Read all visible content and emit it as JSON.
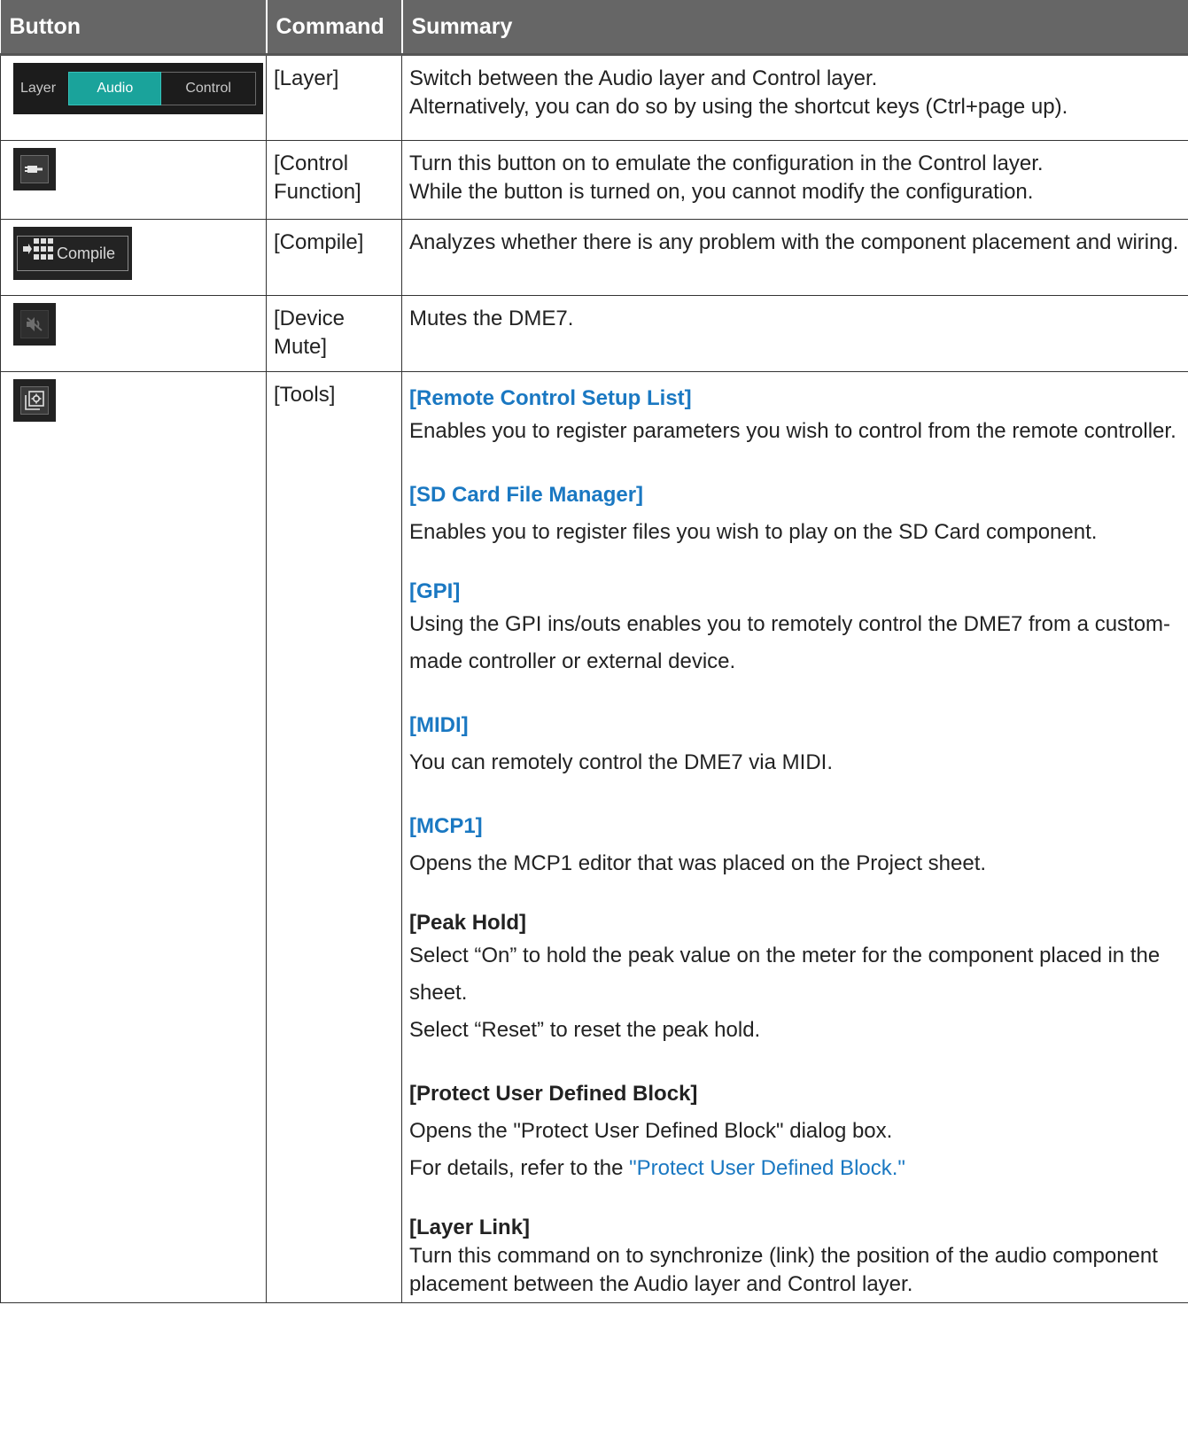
{
  "table": {
    "headers": [
      "Button",
      "Command",
      "Summary"
    ],
    "rows": [
      {
        "button": {
          "type": "layer-switch",
          "label": "Layer",
          "audio": "Audio",
          "control": "Control"
        },
        "command": "[Layer]",
        "summary": [
          "Switch between the Audio layer and Control layer.",
          "Alternatively, you can do so by using the shortcut keys (Ctrl+page up)."
        ]
      },
      {
        "button": {
          "type": "icon",
          "icon": "plug-icon"
        },
        "command": "[Control Function]",
        "summary": [
          "Turn this button on to emulate the configuration in the Control layer.",
          "While the button is turned on, you cannot modify the configuration."
        ]
      },
      {
        "button": {
          "type": "compile",
          "label": "Compile",
          "icon": "compile-grid-icon"
        },
        "command": "[Compile]",
        "summary": [
          "Analyzes whether there is any problem with the component placement and wiring."
        ]
      },
      {
        "button": {
          "type": "icon",
          "icon": "speaker-mute-icon"
        },
        "command": "[Device Mute]",
        "summary": [
          "Mutes the DME7."
        ]
      },
      {
        "button": {
          "type": "icon",
          "icon": "tools-icon"
        },
        "command": "[Tools]",
        "tools": [
          {
            "title": "[Remote Control Setup List]",
            "link": true,
            "lines": [
              "Enables you to register parameters you wish to control from the remote controller."
            ]
          },
          {
            "title": "[SD Card File Manager]",
            "link": true,
            "lines": [
              "Enables you to register files you wish to play on the SD Card component."
            ]
          },
          {
            "title": "[GPI]",
            "link": true,
            "lines": [
              "Using the GPI ins/outs enables you to remotely control the DME7 from a custom-made controller or external device."
            ]
          },
          {
            "title": "[MIDI]",
            "link": true,
            "lines": [
              "You can remotely control the DME7 via MIDI."
            ]
          },
          {
            "title": "[MCP1]",
            "link": true,
            "lines": [
              "Opens the MCP1 editor that was placed on the Project sheet."
            ]
          },
          {
            "title": "[Peak Hold]",
            "link": false,
            "lines": [
              "Select “On” to hold the peak value on the meter for the component placed in the sheet.",
              "Select “Reset” to reset the peak hold."
            ]
          },
          {
            "title": "[Protect User Defined Block]",
            "link": false,
            "lines": [
              "Opens the \"Protect User Defined Block\" dialog box."
            ],
            "ref_prefix": "For details, refer to the ",
            "ref_link": "\"Protect User Defined Block.\""
          },
          {
            "title": "[Layer Link]",
            "link": false,
            "lines": [
              "Turn this command on to synchronize (link) the position of the audio component placement between the Audio layer and Control layer."
            ]
          }
        ]
      }
    ]
  },
  "colors": {
    "header_bg": "#666666",
    "link": "#1a78c2",
    "accent_teal": "#1aa39b"
  }
}
